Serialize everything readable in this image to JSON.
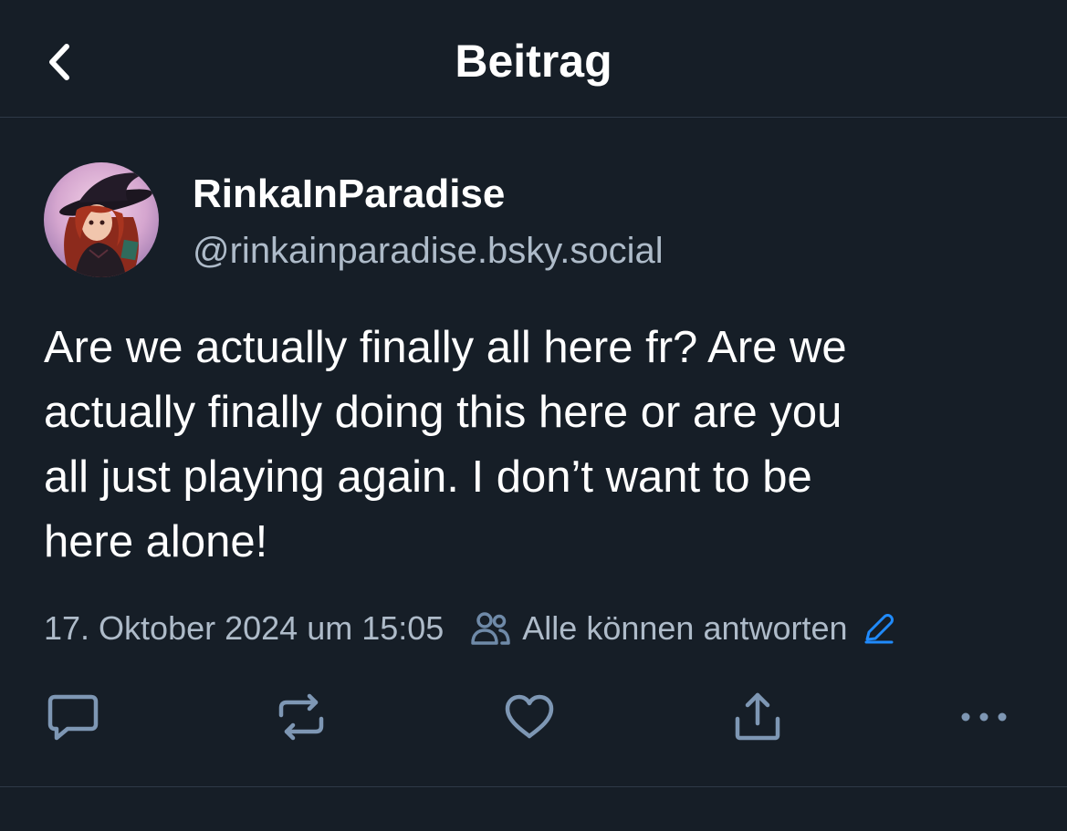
{
  "header": {
    "title": "Beitrag",
    "back_icon": "chevron-left-icon"
  },
  "post": {
    "author": {
      "display_name": "RinkaInParadise",
      "handle": "@rinkainparadise.bsky.social",
      "avatar": "witch-avatar-image"
    },
    "text_lines": [
      "Are we actually finally all here fr? Are we",
      "actually finally doing this here or are you",
      "all just playing again. I don’t want to be",
      "here alone!"
    ],
    "timestamp": "17. Oktober 2024 um 15:05",
    "reply_setting": {
      "label": "Alle können antworten",
      "icon": "people-icon",
      "edit_icon": "pencil-icon"
    }
  },
  "actions": [
    {
      "name": "reply",
      "icon": "comment-icon"
    },
    {
      "name": "repost",
      "icon": "repost-icon"
    },
    {
      "name": "like",
      "icon": "heart-icon"
    },
    {
      "name": "share",
      "icon": "share-icon"
    },
    {
      "name": "more",
      "icon": "more-icon"
    }
  ],
  "colors": {
    "background": "#161e27",
    "divider": "#2e3947",
    "text_primary": "#ffffff",
    "text_secondary": "#aebbc9",
    "icon": "#aebbc9",
    "accent": "#208bfe"
  }
}
